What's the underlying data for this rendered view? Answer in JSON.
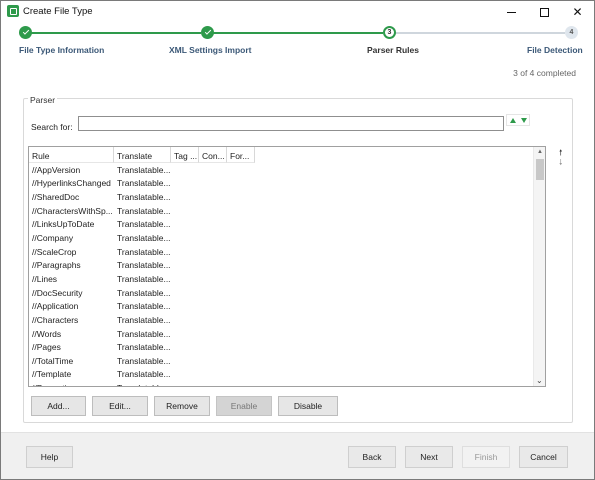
{
  "window": {
    "title": "Create File Type"
  },
  "wizard": {
    "steps": [
      {
        "number": "1",
        "label": "File Type Information",
        "state": "done"
      },
      {
        "number": "2",
        "label": "XML Settings Import",
        "state": "done"
      },
      {
        "number": "3",
        "label": "Parser Rules",
        "state": "current"
      },
      {
        "number": "4",
        "label": "File Detection",
        "state": "todo"
      }
    ],
    "progress_text": "3 of 4 completed"
  },
  "parser": {
    "group_title": "Parser",
    "search_label": "Search for:",
    "search_value": "",
    "columns": [
      "Rule",
      "Translate",
      "Tag ...",
      "Con...",
      "For..."
    ],
    "rows": [
      {
        "rule": "//AppVersion",
        "translate": "Translatable..."
      },
      {
        "rule": "//HyperlinksChanged",
        "translate": "Translatable..."
      },
      {
        "rule": "//SharedDoc",
        "translate": "Translatable..."
      },
      {
        "rule": "//CharactersWithSp...",
        "translate": "Translatable..."
      },
      {
        "rule": "//LinksUpToDate",
        "translate": "Translatable..."
      },
      {
        "rule": "//Company",
        "translate": "Translatable..."
      },
      {
        "rule": "//ScaleCrop",
        "translate": "Translatable..."
      },
      {
        "rule": "//Paragraphs",
        "translate": "Translatable..."
      },
      {
        "rule": "//Lines",
        "translate": "Translatable..."
      },
      {
        "rule": "//DocSecurity",
        "translate": "Translatable..."
      },
      {
        "rule": "//Application",
        "translate": "Translatable..."
      },
      {
        "rule": "//Characters",
        "translate": "Translatable..."
      },
      {
        "rule": "//Words",
        "translate": "Translatable..."
      },
      {
        "rule": "//Pages",
        "translate": "Translatable..."
      },
      {
        "rule": "//TotalTime",
        "translate": "Translatable..."
      },
      {
        "rule": "//Template",
        "translate": "Translatable..."
      },
      {
        "rule": "//Properties",
        "translate": "Translatable..."
      }
    ],
    "buttons": {
      "add": "Add...",
      "edit": "Edit...",
      "remove": "Remove",
      "enable": "Enable",
      "disable": "Disable"
    }
  },
  "footer": {
    "help": "Help",
    "back": "Back",
    "next": "Next",
    "finish": "Finish",
    "cancel": "Cancel"
  },
  "colors": {
    "accent_green": "#2e9a4b",
    "step_label_blue": "#3b5877"
  }
}
